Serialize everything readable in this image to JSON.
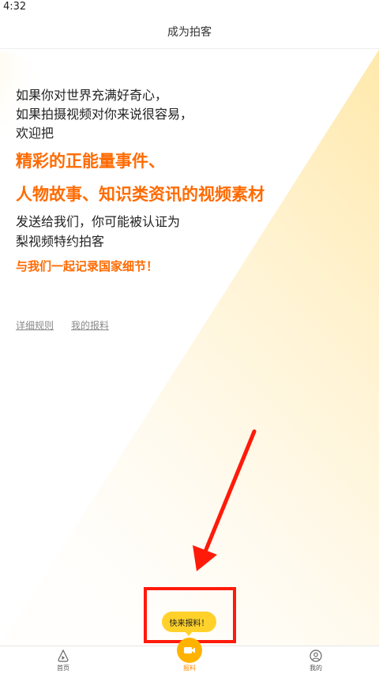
{
  "status_bar": {
    "time": "4:32"
  },
  "nav": {
    "title": "成为拍客"
  },
  "intro": {
    "line1": "如果你对世界充满好奇心，",
    "line2": "如果拍摄视频对你来说很容易，",
    "line3": "欢迎把",
    "highlight1": "精彩的正能量事件、",
    "highlight2": "人物故事、知识类资讯的视频素材",
    "line4": "发送给我们，你可能被认证为",
    "line5": "梨视频特约拍客",
    "cta": "与我们一起记录国家细节！"
  },
  "links": {
    "rules": "详细规则",
    "my_reports": "我的报料"
  },
  "tooltip": {
    "text": "快来报料！"
  },
  "tabs": [
    {
      "label": "首页",
      "icon": "home-play-icon"
    },
    {
      "label": "报料",
      "icon": "camera-icon"
    },
    {
      "label": "我的",
      "icon": "user-icon"
    }
  ],
  "colors": {
    "accent": "#ff6a00",
    "tooltip": "#ffd12a",
    "annotation": "#ff1a0a",
    "tab_active": "#ff8a00"
  }
}
